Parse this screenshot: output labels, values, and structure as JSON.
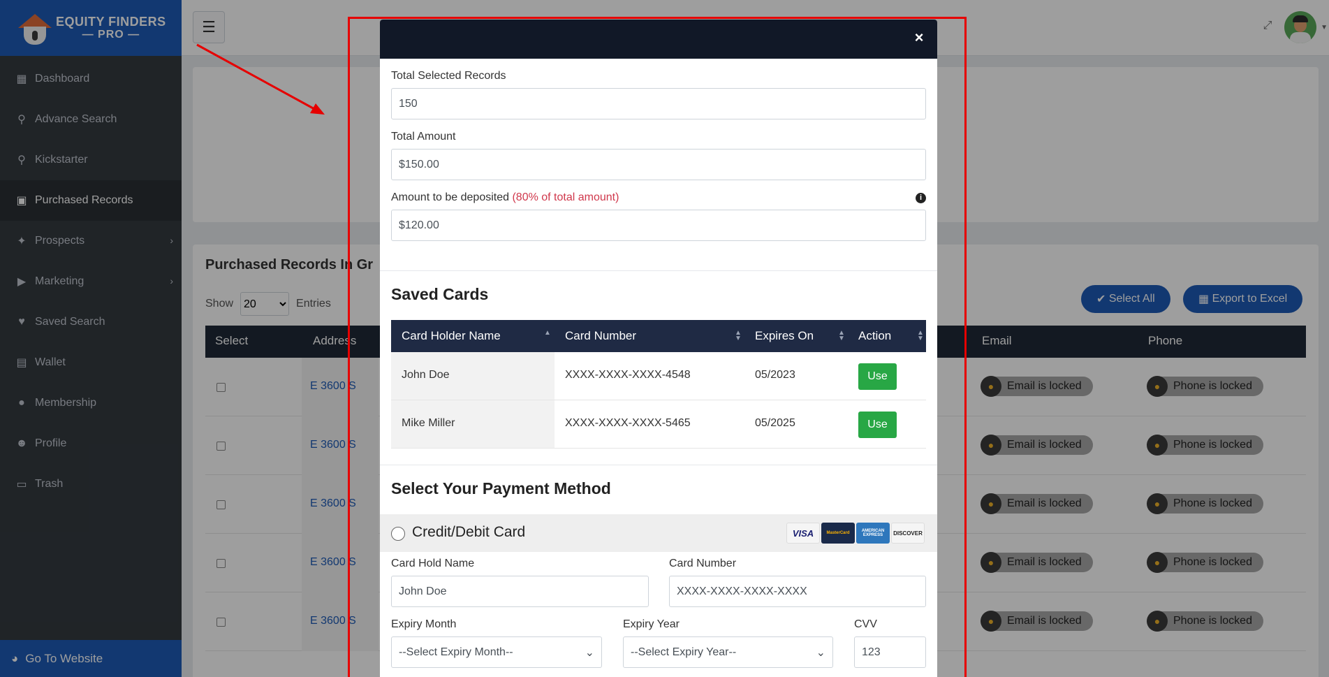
{
  "brand": {
    "line1": "EQUITY FINDERS",
    "line2": "PRO"
  },
  "sidebar": {
    "items": [
      {
        "label": "Dashboard",
        "icon": "dashboard-icon"
      },
      {
        "label": "Advance Search",
        "icon": "search-icon"
      },
      {
        "label": "Kickstarter",
        "icon": "search-icon"
      },
      {
        "label": "Purchased Records",
        "icon": "shopping-bag-icon"
      },
      {
        "label": "Prospects",
        "icon": "fire-icon"
      },
      {
        "label": "Marketing",
        "icon": "bullhorn-icon"
      },
      {
        "label": "Saved Search",
        "icon": "heart-icon"
      },
      {
        "label": "Wallet",
        "icon": "wallet-icon"
      },
      {
        "label": "Membership",
        "icon": "users-icon"
      },
      {
        "label": "Profile",
        "icon": "user-icon"
      },
      {
        "label": "Trash",
        "icon": "trash-icon"
      }
    ],
    "footer": "Go To Website"
  },
  "page": {
    "section_title": "Purchased Records In Gr",
    "show_label": "Show",
    "entries_value": "20",
    "entries_label": "Entries",
    "select_all": "Select All",
    "export_excel": "Export to Excel",
    "columns": {
      "select": "Select",
      "address": "Address",
      "email": "Email",
      "phone": "Phone"
    },
    "rows": [
      {
        "address": "E 3600 S",
        "email": "Email is locked",
        "phone": "Phone is locked"
      },
      {
        "address": "E 3600 S",
        "email": "Email is locked",
        "phone": "Phone is locked"
      },
      {
        "address": "E 3600 S",
        "email": "Email is locked",
        "phone": "Phone is locked"
      },
      {
        "address": "E 3600 S",
        "email": "Email is locked",
        "phone": "Phone is locked"
      },
      {
        "address": "E 3600 S",
        "email": "Email is locked",
        "phone": "Phone is locked"
      }
    ]
  },
  "modal": {
    "close": "×",
    "total_records_label": "Total Selected Records",
    "total_records_value": "150",
    "total_amount_label": "Total Amount",
    "total_amount_value": "$150.00",
    "deposit_label": "Amount to be deposited",
    "deposit_note": "(80% of total amount)",
    "deposit_value": "$120.00",
    "saved_cards_title": "Saved Cards",
    "card_columns": {
      "holder": "Card Holder Name",
      "number": "Card Number",
      "expires": "Expires On",
      "action": "Action"
    },
    "cards": [
      {
        "holder": "John Doe",
        "number": "XXXX-XXXX-XXXX-4548",
        "expires": "05/2023",
        "action": "Use"
      },
      {
        "holder": "Mike Miller",
        "number": "XXXX-XXXX-XXXX-5465",
        "expires": "05/2025",
        "action": "Use"
      }
    ],
    "payment_title": "Select Your Payment Method",
    "payment_option": "Credit/Debit Card",
    "card_logos": [
      "VISA",
      "MasterCard",
      "AMERICAN EXPRESS",
      "DISCOVER"
    ],
    "card_hold_name_label": "Card Hold Name",
    "card_hold_name_placeholder": "John Doe",
    "card_number_label": "Card Number",
    "card_number_placeholder": "XXXX-XXXX-XXXX-XXXX",
    "expiry_month_label": "Expiry Month",
    "expiry_month_value": "--Select Expiry Month--",
    "expiry_year_label": "Expiry Year",
    "expiry_year_value": "--Select Expiry Year--",
    "cvv_label": "CVV",
    "cvv_placeholder": "123"
  },
  "colors": {
    "sidebar": "#343a40",
    "brand": "#1e5bb7",
    "modal_header": "#111827",
    "use_button": "#28a745",
    "annotation": "#e60000"
  }
}
